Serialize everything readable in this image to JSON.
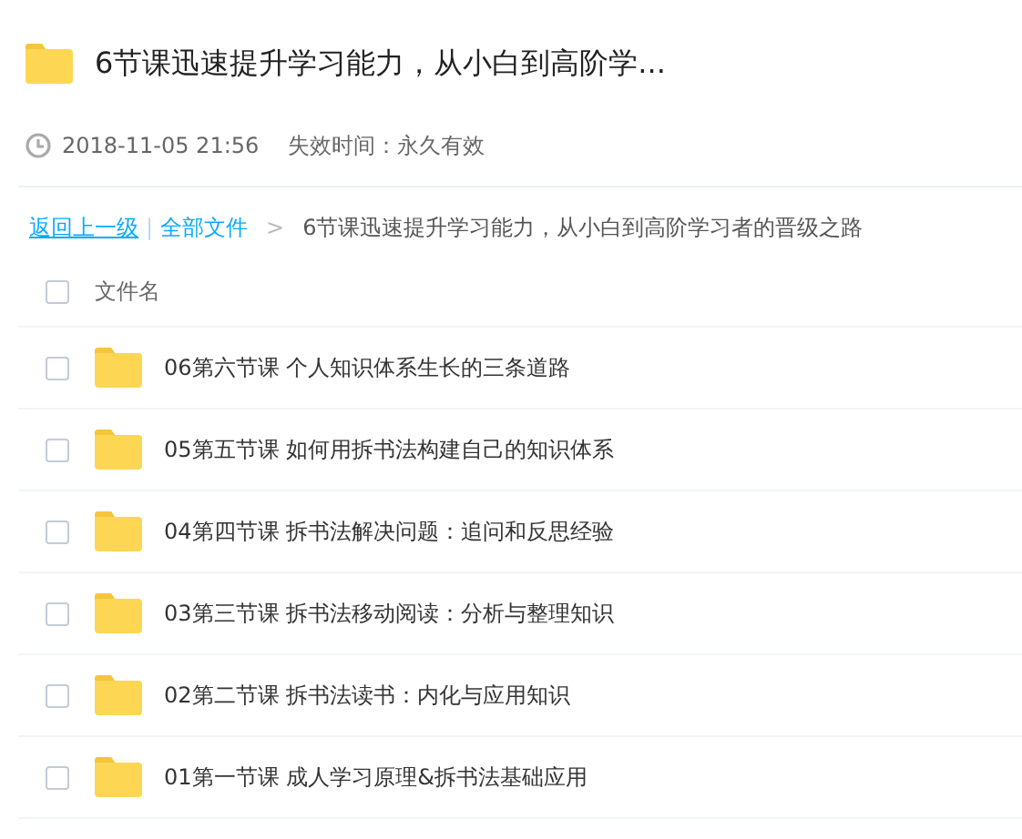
{
  "share": {
    "title": "6节课迅速提升学习能力，从小白到高阶学...",
    "time": "2018-11-05 21:56",
    "expiry": "失效时间：永久有效"
  },
  "breadcrumb": {
    "back": "返回上一级",
    "separator": "|",
    "root": "全部文件",
    "arrow": ">",
    "current": "6节课迅速提升学习能力，从小白到高阶学习者的晋级之路"
  },
  "table": {
    "header": {
      "label": "文件名",
      "checked": false
    },
    "rows": [
      {
        "name": "06第六节课 个人知识体系生长的三条道路",
        "checked": false
      },
      {
        "name": "05第五节课 如何用拆书法构建自己的知识体系",
        "checked": false
      },
      {
        "name": "04第四节课 拆书法解决问题：追问和反思经验",
        "checked": false
      },
      {
        "name": "03第三节课 拆书法移动阅读：分析与整理知识",
        "checked": false
      },
      {
        "name": "02第二节课 拆书法读书：内化与应用知识",
        "checked": false
      },
      {
        "name": "01第一节课 成人学习原理&拆书法基础应用",
        "checked": false
      }
    ]
  }
}
